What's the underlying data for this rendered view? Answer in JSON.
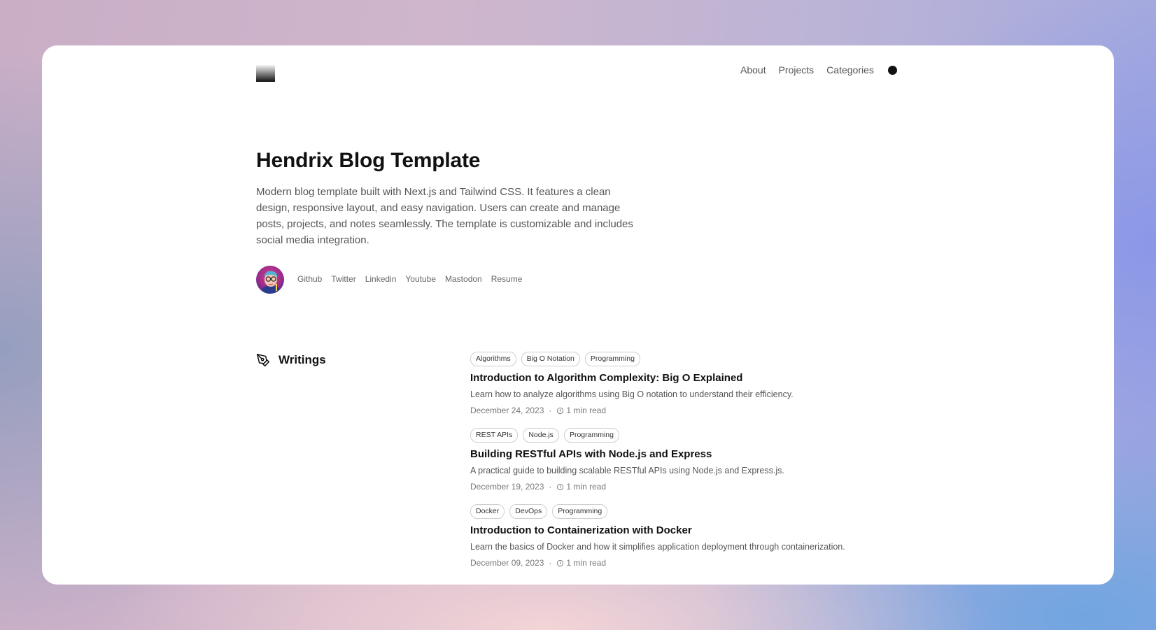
{
  "colors": {
    "accent": "#111111",
    "text_muted": "#555555",
    "card_bg": "#ffffff"
  },
  "nav": {
    "items": [
      {
        "label": "About"
      },
      {
        "label": "Projects"
      },
      {
        "label": "Categories"
      }
    ],
    "theme_toggle_icon": "circle-icon"
  },
  "hero": {
    "title": "Hendrix Blog Template",
    "description": "Modern blog template built with Next.js and Tailwind CSS. It features a clean design, responsive layout, and easy navigation. Users can create and manage posts, projects, and notes seamlessly. The template is customizable and includes social media integration.",
    "socials": [
      {
        "label": "Github"
      },
      {
        "label": "Twitter"
      },
      {
        "label": "Linkedin"
      },
      {
        "label": "Youtube"
      },
      {
        "label": "Mastodon"
      },
      {
        "label": "Resume"
      }
    ]
  },
  "writings": {
    "heading": "Writings",
    "icon": "pen-nib-icon",
    "posts": [
      {
        "tags": [
          "Algorithms",
          "Big O Notation",
          "Programming"
        ],
        "title": "Introduction to Algorithm Complexity: Big O Explained",
        "description": "Learn how to analyze algorithms using Big O notation to understand their efficiency.",
        "date": "December 24, 2023",
        "read_time": "1 min read"
      },
      {
        "tags": [
          "REST APIs",
          "Node.js",
          "Programming"
        ],
        "title": "Building RESTful APIs with Node.js and Express",
        "description": "A practical guide to building scalable RESTful APIs using Node.js and Express.js.",
        "date": "December 19, 2023",
        "read_time": "1 min read"
      },
      {
        "tags": [
          "Docker",
          "DevOps",
          "Programming"
        ],
        "title": "Introduction to Containerization with Docker",
        "description": "Learn the basics of Docker and how it simplifies application deployment through containerization.",
        "date": "December 09, 2023",
        "read_time": "1 min read"
      }
    ]
  }
}
